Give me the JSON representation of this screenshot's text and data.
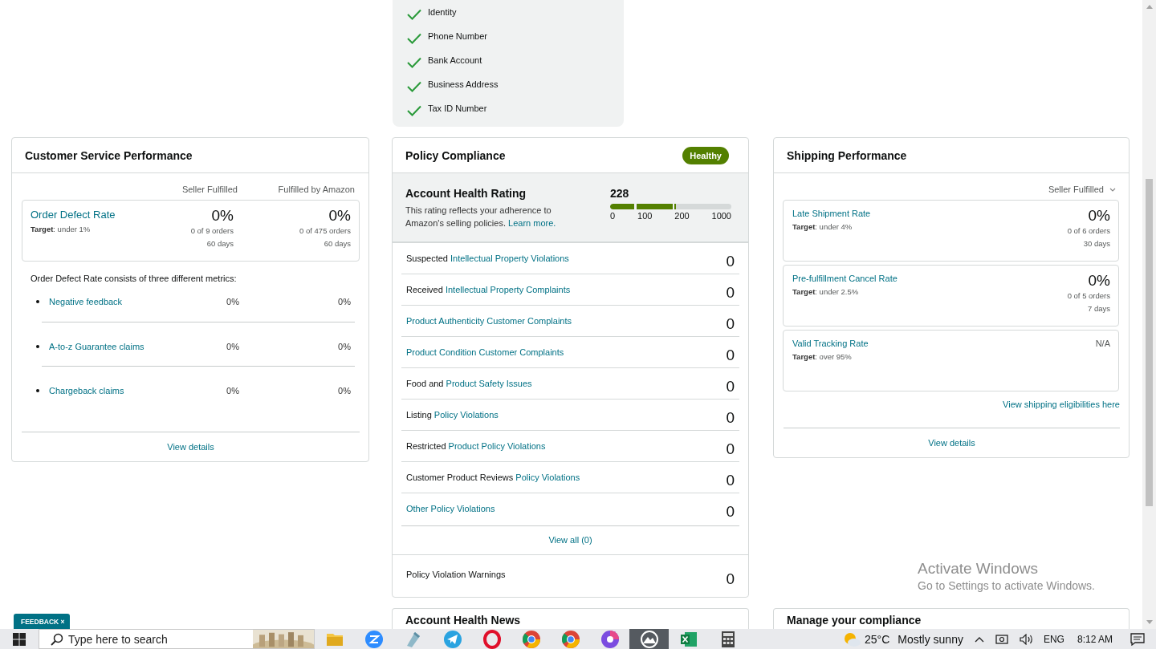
{
  "verification": {
    "items": [
      {
        "label": "Identity",
        "checked": true
      },
      {
        "label": "Phone Number",
        "checked": true
      },
      {
        "label": "Bank Account",
        "checked": true
      },
      {
        "label": "Business Address",
        "checked": true
      },
      {
        "label": "Tax ID Number",
        "checked": true
      }
    ]
  },
  "customer_service": {
    "title": "Customer Service Performance",
    "columns": [
      "Seller Fulfilled",
      "Fulfilled by Amazon"
    ],
    "odr": {
      "name": "Order Defect Rate",
      "target": "**Target**: under 1%",
      "values": [
        {
          "value": "0%",
          "orders": "0 of 9 orders",
          "period": "60 days"
        },
        {
          "value": "0%",
          "orders": "0 of 475 orders",
          "period": "60 days"
        }
      ]
    },
    "intro": "Order Defect Rate consists of three different metrics:",
    "metrics": [
      {
        "name": "Negative feedback",
        "values": [
          "0%",
          "0%"
        ]
      },
      {
        "name": "A-to-z Guarantee claims",
        "values": [
          "0%",
          "0%"
        ]
      },
      {
        "name": "Chargeback claims",
        "values": [
          "0%",
          "0%"
        ]
      }
    ],
    "link": "View details"
  },
  "policy": {
    "title": "Policy Compliance",
    "badge": "Healthy",
    "rating": {
      "title": "Account Health Rating",
      "description": "This rating reflects your adherence to Amazon's selling policies.",
      "link": "Learn more.",
      "score": "228",
      "level": 0.54,
      "ticks": [
        "0",
        "100",
        "200",
        "1000"
      ]
    },
    "violations": [
      {
        "prefix": "Suspected",
        "link": "Intellectual Property Violations",
        "count": "0"
      },
      {
        "prefix": "Received",
        "link": "Intellectual Property Complaints",
        "count": "0"
      },
      {
        "link": "Product Authenticity Customer Complaints",
        "count": "0"
      },
      {
        "link": "Product Condition Customer Complaints",
        "count": "0"
      },
      {
        "prefix": "Food and",
        "link": "Product Safety Issues",
        "count": "0"
      },
      {
        "prefix": "Listing",
        "link": "Policy Violations",
        "count": "0"
      },
      {
        "prefix": "Restricted",
        "link": "Product Policy Violations",
        "count": "0"
      },
      {
        "prefix": "Customer Product Reviews",
        "link": "Policy Violations",
        "count": "0"
      },
      {
        "link": "Other Policy Violations",
        "count": "0"
      }
    ],
    "view_all": "View all (0)",
    "warnings": {
      "name": "Policy Violation Warnings",
      "count": "0"
    }
  },
  "shipping": {
    "title": "Shipping Performance",
    "filter": "Seller Fulfilled",
    "metrics": [
      {
        "name": "Late Shipment Rate",
        "target": "**Target**: under 4%",
        "value": "0%",
        "orders": "0 of 6 orders",
        "period": "30 days"
      },
      {
        "name": "Pre-fulfillment Cancel Rate",
        "target": "**Target**: under 2.5%",
        "value": "0%",
        "orders": "0 of 5 orders",
        "period": "7 days"
      },
      {
        "name": "Valid Tracking Rate",
        "target": "**Target**: over 95%",
        "value": "N/A"
      }
    ],
    "eligibility_link": "View shipping eligibilities here",
    "link": "View details"
  },
  "bottom_cards": [
    {
      "title": "Account Health News"
    },
    {
      "title": "Manage your compliance"
    }
  ],
  "feedback": {
    "label": "FEEDBACK",
    "close": "×"
  },
  "activation": {
    "title": "Activate Windows",
    "subtitle": "Go to Settings to activate Windows."
  },
  "taskbar": {
    "search_placeholder": "Type here to search",
    "apps": [
      {
        "kind": "folder",
        "active": false
      },
      {
        "kind": "zoom",
        "active": false
      },
      {
        "kind": "tool",
        "active": false
      },
      {
        "kind": "telegram",
        "active": false
      },
      {
        "kind": "opera",
        "active": false
      },
      {
        "kind": "chrome",
        "active": false
      },
      {
        "kind": "chrome",
        "active": false
      },
      {
        "kind": "browser",
        "active": false
      },
      {
        "kind": "mountain",
        "active": true
      },
      {
        "kind": "excel",
        "active": false
      },
      {
        "kind": "calculator",
        "active": false
      }
    ],
    "temperature": "25°C",
    "weather": "Mostly sunny",
    "language": "ENG",
    "time": "8:12 AM"
  }
}
